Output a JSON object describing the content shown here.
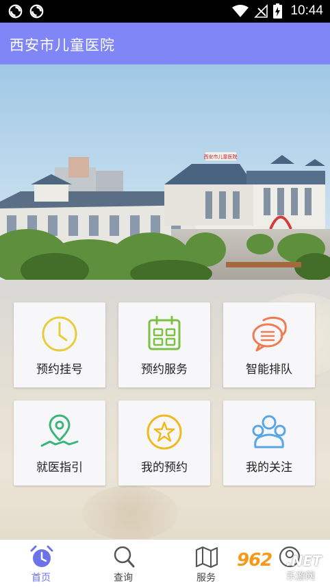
{
  "status_bar": {
    "time": "10:44",
    "icons": [
      "sync-icon",
      "sync-icon",
      "wifi-icon",
      "no-signal-icon",
      "battery-charging-icon"
    ]
  },
  "app_bar": {
    "title": "西安市儿童医院"
  },
  "banner": {
    "image": "hospital-building-photo",
    "sign_text": "西安市儿童医院"
  },
  "tiles": [
    {
      "label": "预约挂号",
      "icon": "clock-icon",
      "color": "#e8cc3a"
    },
    {
      "label": "预约服务",
      "icon": "calendar-icon",
      "color": "#7cc142"
    },
    {
      "label": "智能排队",
      "icon": "chat-bubbles-icon",
      "color": "#f07a52"
    },
    {
      "label": "就医指引",
      "icon": "location-pin-icon",
      "color": "#3ab57a"
    },
    {
      "label": "我的预约",
      "icon": "star-icon",
      "color": "#f1b81c"
    },
    {
      "label": "我的关注",
      "icon": "people-icon",
      "color": "#56a6e8"
    }
  ],
  "bottom_nav": [
    {
      "label": "首页",
      "icon": "alarm-clock-icon",
      "active": true
    },
    {
      "label": "查询",
      "icon": "search-icon",
      "active": false
    },
    {
      "label": "服务",
      "icon": "map-icon",
      "active": false
    },
    {
      "label": "",
      "icon": "user-icon",
      "active": false
    }
  ],
  "watermark": {
    "brand": "962",
    "suffix": ".NET",
    "sub": "乐游网"
  }
}
